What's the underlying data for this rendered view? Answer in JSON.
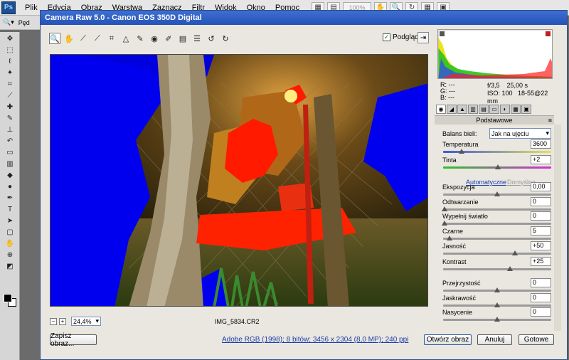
{
  "ps": {
    "logo": "Ps",
    "menu": [
      "Plik",
      "Edycja",
      "Obraz",
      "Warstwa",
      "Zaznacz",
      "Filtr",
      "Widok",
      "Okno",
      "Pomoc"
    ],
    "zoom_placeholder": "100%",
    "options_text": "Pęd"
  },
  "window": {
    "title": "Camera Raw 5.0  -  Canon EOS 350D Digital",
    "preview_label": "Podgląd",
    "filename": "IMG_5834.CR2",
    "zoom": "24,4%",
    "save_button": "Zapisz obraz...",
    "open_button": "Otwórz obraz",
    "cancel_button": "Anuluj",
    "done_button": "Gotowe",
    "workflow_info": "Adobe RGB (1998); 8 bitów; 3456 x 2304 (8,0 MP); 240 ppi"
  },
  "exif": {
    "r": "R:  ---",
    "g": "G:  ---",
    "b": "B:  ---",
    "aperture": "f/3,5",
    "shutter": "25,00 s",
    "iso": "ISO: 100",
    "lens": "18-55@22 mm"
  },
  "panel": {
    "title": "Podstawowe",
    "wb_label": "Balans bieli:",
    "wb_value": "Jak na ujęciu",
    "auto_link": "Automatyczne",
    "default_link": "Domyślne",
    "sliders": [
      {
        "label": "Temperatura",
        "value": "3600",
        "level": 0.16
      },
      {
        "label": "Tinta",
        "value": "+2",
        "level": 0.51
      },
      {
        "label": "Ekspozycja",
        "value": "0,00",
        "level": 0.5
      },
      {
        "label": "Odtwarzanie",
        "value": "0",
        "level": 0.0
      },
      {
        "label": "Wypełnij światło",
        "value": "0",
        "level": 0.0
      },
      {
        "label": "Czarne",
        "value": "5",
        "level": 0.05
      },
      {
        "label": "Jasność",
        "value": "+50",
        "level": 0.67
      },
      {
        "label": "Kontrast",
        "value": "+25",
        "level": 0.62
      },
      {
        "label": "Przejrzystość",
        "value": "0",
        "level": 0.5
      },
      {
        "label": "Jaskrawość",
        "value": "0",
        "level": 0.5
      },
      {
        "label": "Nasycenie",
        "value": "0",
        "level": 0.5
      }
    ]
  },
  "colors": {
    "highlight_clip": "#ff1a00",
    "shadow_clip": "#0000ff",
    "title_bar": "#2553b8"
  }
}
